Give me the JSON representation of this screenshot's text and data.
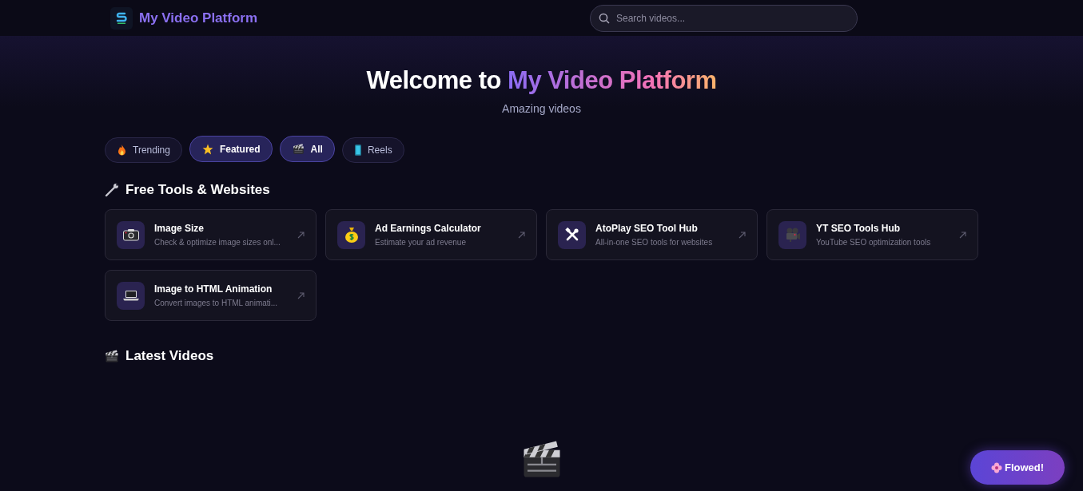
{
  "header": {
    "brand": "My Video Platform",
    "search": {
      "placeholder": "Search videos..."
    }
  },
  "hero": {
    "title_start": "Welcome to",
    "title_highlight": "My Video Platform",
    "subtitle": "Amazing videos"
  },
  "filters": [
    {
      "label": "Trending",
      "selected": false
    },
    {
      "label": "Featured",
      "selected": true
    },
    {
      "label": "All",
      "selected": true
    },
    {
      "label": "Reels",
      "selected": false
    }
  ],
  "tools_section": {
    "title": "Free Tools & Websites",
    "tools": [
      {
        "name": "Image Size",
        "description": "Check & optimize image sizes onl..."
      },
      {
        "name": "Ad Earnings Calculator",
        "description": "Estimate your ad revenue"
      },
      {
        "name": "AtoPlay SEO Tool Hub",
        "description": "All-in-one SEO tools for websites"
      },
      {
        "name": "YT SEO Tools Hub",
        "description": "YouTube SEO optimization tools"
      },
      {
        "name": "Image to HTML Animation",
        "description": "Convert images to HTML animati..."
      }
    ]
  },
  "videos_section": {
    "title": "Latest Videos"
  },
  "floating_button": {
    "label": "Flowed!"
  }
}
